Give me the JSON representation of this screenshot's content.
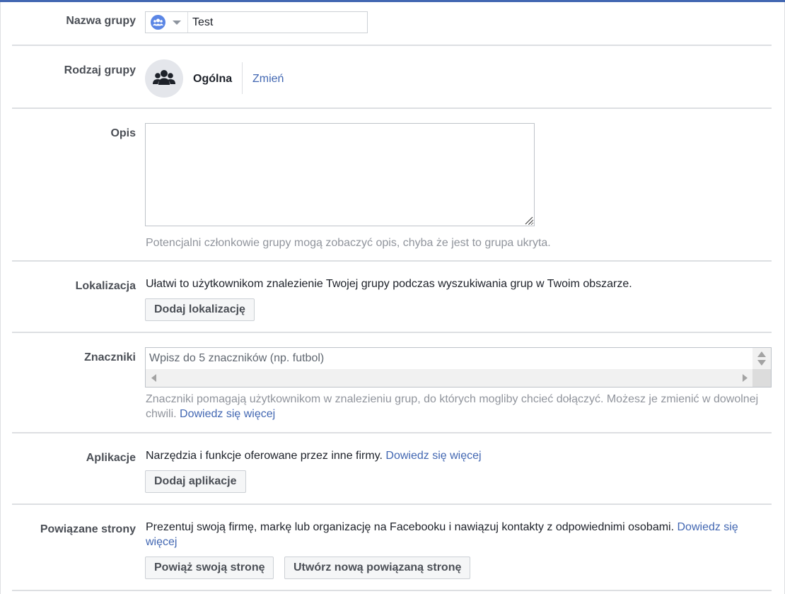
{
  "group_name": {
    "label": "Nazwa grupy",
    "value": "Test"
  },
  "group_type": {
    "label": "Rodzaj grupy",
    "value": "Ogólna",
    "change_link": "Zmień"
  },
  "description": {
    "label": "Opis",
    "value": "",
    "help": "Potencjalni członkowie grupy mogą zobaczyć opis, chyba że jest to grupa ukryta."
  },
  "location": {
    "label": "Lokalizacja",
    "text": "Ułatwi to użytkownikom znalezienie Twojej grupy podczas wyszukiwania grup w Twoim obszarze.",
    "button": "Dodaj lokalizację"
  },
  "tags": {
    "label": "Znaczniki",
    "placeholder": "Wpisz do 5 znaczników (np. futbol)",
    "help_line1": "Znaczniki pomagają użytkownikom w znalezieniu grup, do których mogliby chcieć dołączyć. Możesz je zmienić w dowolnej",
    "help_line2": "chwili.",
    "learn_more": "Dowiedz się więcej"
  },
  "apps": {
    "label": "Aplikacje",
    "text": "Narzędzia i funkcje oferowane przez inne firmy.",
    "learn_more": "Dowiedz się więcej",
    "button": "Dodaj aplikacje"
  },
  "linked_pages": {
    "label": "Powiązane strony",
    "text": "Prezentuj swoją firmę, markę lub organizację na Facebooku i nawiązuj kontakty z odpowiednimi osobami.",
    "learn_more_1": "Dowiedz się",
    "learn_more_2": "więcej",
    "button_link": "Powiąż swoją stronę",
    "button_create": "Utwórz nową powiązaną stronę"
  },
  "colors": {
    "accent": "#4267b2",
    "border": "#dddfe2",
    "label": "#4b4f56",
    "help": "#90949c"
  },
  "icons": {
    "group_selector": "group-icon",
    "dropdown": "caret-down-icon",
    "group_type": "people-icon"
  }
}
